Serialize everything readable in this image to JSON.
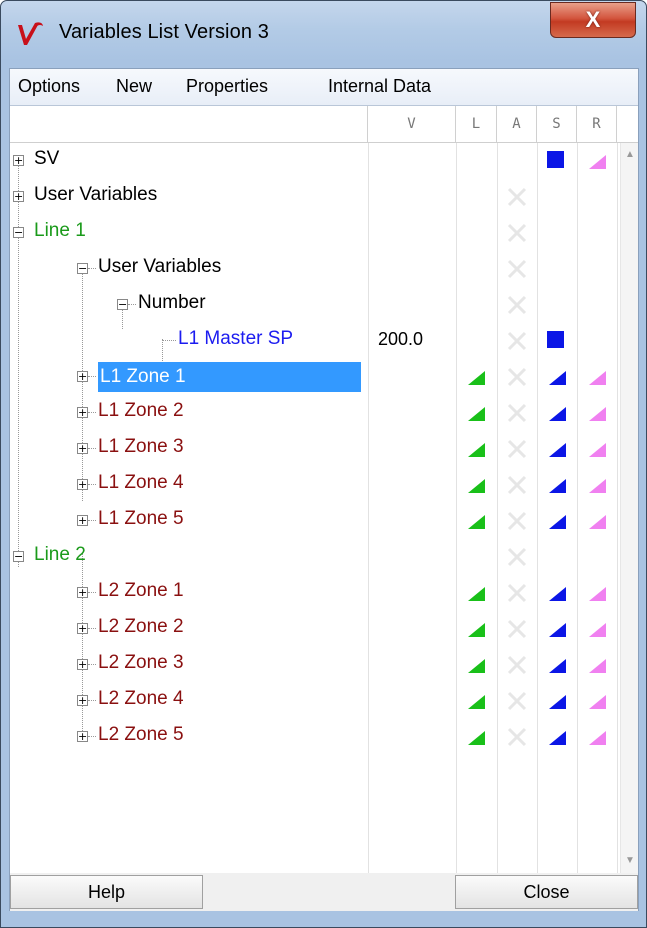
{
  "window": {
    "title": "Variables List Version 3",
    "close_glyph": "X",
    "app_icon": "v-logo-icon"
  },
  "menu": [
    "Options",
    "New",
    "Properties",
    "Internal Data"
  ],
  "columns": [
    "V",
    "L",
    "A",
    "S",
    "R"
  ],
  "rows": [
    {
      "label": "SV",
      "color": "black",
      "value": "",
      "L": "",
      "A": "",
      "S": "square",
      "R": "pink"
    },
    {
      "label": "User Variables",
      "color": "black",
      "value": "",
      "L": "",
      "A": "x",
      "S": "",
      "R": ""
    },
    {
      "label": "Line 1",
      "color": "green",
      "value": "",
      "L": "",
      "A": "x",
      "S": "",
      "R": ""
    },
    {
      "label": "User Variables",
      "color": "black",
      "value": "",
      "L": "",
      "A": "x",
      "S": "",
      "R": ""
    },
    {
      "label": "Number",
      "color": "black",
      "value": "",
      "L": "",
      "A": "x",
      "S": "",
      "R": ""
    },
    {
      "label": "L1 Master SP",
      "color": "blue",
      "value": "200.0",
      "L": "",
      "A": "x",
      "S": "square",
      "R": ""
    },
    {
      "label": "L1 Zone 1",
      "color": "red",
      "selected": true,
      "value": "",
      "L": "green",
      "A": "x",
      "S": "blue",
      "R": "pink"
    },
    {
      "label": "L1 Zone 2",
      "color": "red",
      "value": "",
      "L": "green",
      "A": "x",
      "S": "blue",
      "R": "pink"
    },
    {
      "label": "L1 Zone 3",
      "color": "red",
      "value": "",
      "L": "green",
      "A": "x",
      "S": "blue",
      "R": "pink"
    },
    {
      "label": "L1 Zone 4",
      "color": "red",
      "value": "",
      "L": "green",
      "A": "x",
      "S": "blue",
      "R": "pink"
    },
    {
      "label": "L1 Zone 5",
      "color": "red",
      "value": "",
      "L": "green",
      "A": "x",
      "S": "blue",
      "R": "pink"
    },
    {
      "label": "Line 2",
      "color": "green",
      "value": "",
      "L": "",
      "A": "x",
      "S": "",
      "R": ""
    },
    {
      "label": "L2 Zone 1",
      "color": "red",
      "value": "",
      "L": "green",
      "A": "x",
      "S": "blue",
      "R": "pink"
    },
    {
      "label": "L2 Zone 2",
      "color": "red",
      "value": "",
      "L": "green",
      "A": "x",
      "S": "blue",
      "R": "pink"
    },
    {
      "label": "L2 Zone 3",
      "color": "red",
      "value": "",
      "L": "green",
      "A": "x",
      "S": "blue",
      "R": "pink"
    },
    {
      "label": "L2 Zone 4",
      "color": "red",
      "value": "",
      "L": "green",
      "A": "x",
      "S": "blue",
      "R": "pink"
    },
    {
      "label": "L2 Zone 5",
      "color": "red",
      "value": "",
      "L": "green",
      "A": "x",
      "S": "blue",
      "R": "pink"
    }
  ],
  "buttons": {
    "help": "Help",
    "close": "Close"
  },
  "colors": {
    "green_label": "#1a9a1a",
    "blue_label": "#1c1cf0",
    "red_label": "#8a1010",
    "selection": "#3399ff"
  }
}
